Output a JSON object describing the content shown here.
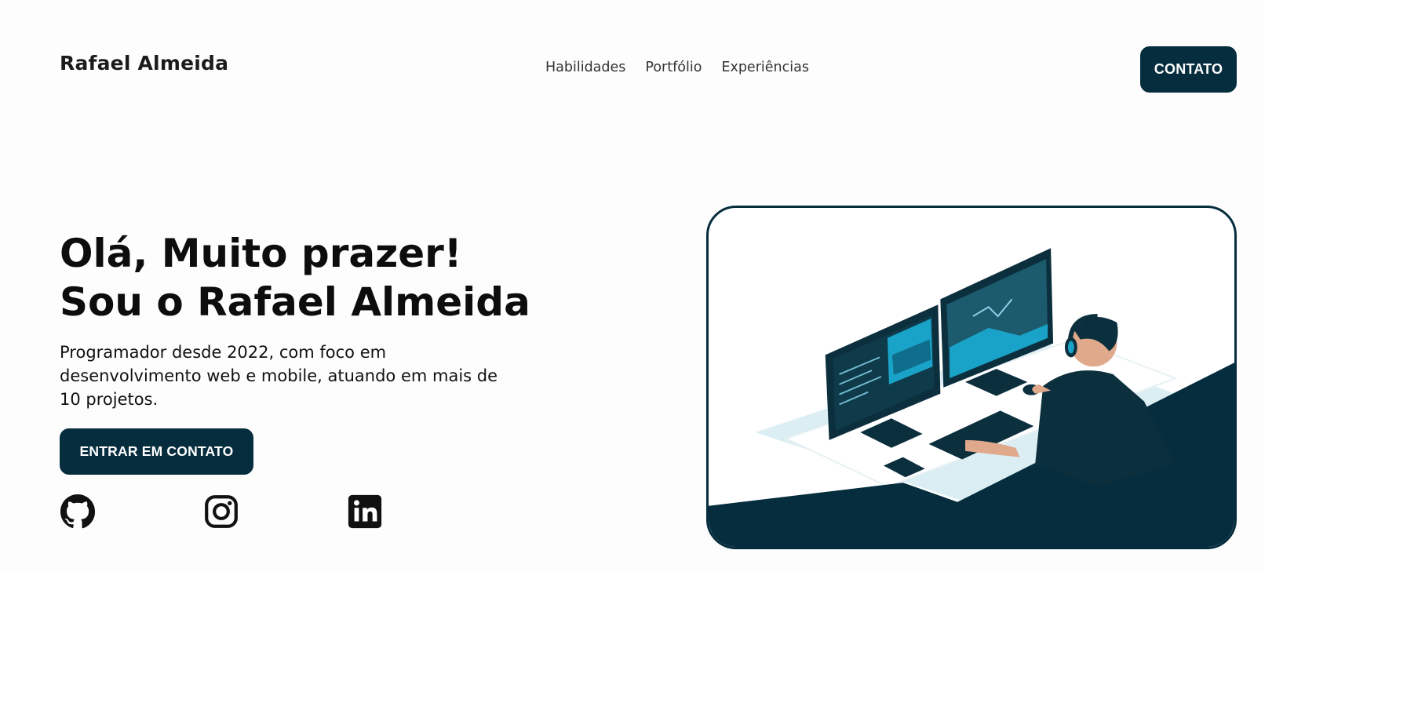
{
  "header": {
    "brand": "Rafael Almeida",
    "nav": [
      {
        "label": "Habilidades"
      },
      {
        "label": "Portfólio"
      },
      {
        "label": "Experiências"
      }
    ],
    "contact_button": "CONTATO"
  },
  "hero": {
    "title_line1": "Olá, Muito prazer!",
    "title_line2": "Sou o Rafael Almeida",
    "description": "Programador desde 2022, com foco em desenvolvimento web e mobile, atuando em mais de 10 projetos.",
    "cta_button": "ENTRAR EM CONTATO",
    "socials": [
      {
        "icon": "github-icon"
      },
      {
        "icon": "instagram-icon"
      },
      {
        "icon": "linkedin-icon"
      }
    ]
  },
  "colors": {
    "primary": "#062d3e",
    "accent": "#1aa3c8",
    "background": "#ffffff",
    "text": "#0d0d0d"
  }
}
